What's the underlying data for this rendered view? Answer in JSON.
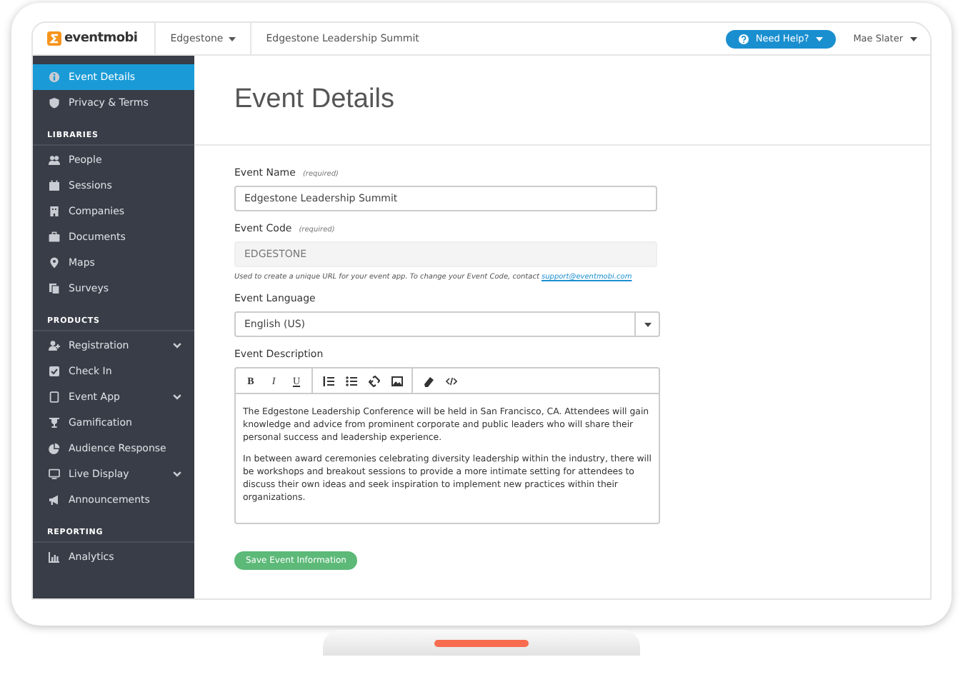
{
  "header": {
    "logo": "eventmobi",
    "organization": "Edgestone",
    "event": "Edgestone Leadership Summit",
    "help_button": "Need Help?",
    "user": "Mae Slater"
  },
  "sidebar": {
    "sections": [
      {
        "items": [
          {
            "label": "Event Details",
            "selected": true,
            "expandable": false
          },
          {
            "label": "Privacy & Terms",
            "selected": false,
            "expandable": false
          }
        ]
      },
      {
        "heading": "LIBRARIES",
        "items": [
          {
            "label": "People",
            "selected": false,
            "expandable": false
          },
          {
            "label": "Sessions",
            "selected": false,
            "expandable": false
          },
          {
            "label": "Companies",
            "selected": false,
            "expandable": false
          },
          {
            "label": "Documents",
            "selected": false,
            "expandable": false
          },
          {
            "label": "Maps",
            "selected": false,
            "expandable": false
          },
          {
            "label": "Surveys",
            "selected": false,
            "expandable": false
          }
        ]
      },
      {
        "heading": "PRODUCTS",
        "items": [
          {
            "label": "Registration",
            "selected": false,
            "expandable": true
          },
          {
            "label": "Check In",
            "selected": false,
            "expandable": false
          },
          {
            "label": "Event App",
            "selected": false,
            "expandable": true
          },
          {
            "label": "Gamification",
            "selected": false,
            "expandable": false
          },
          {
            "label": "Audience Response",
            "selected": false,
            "expandable": false
          },
          {
            "label": "Live Display",
            "selected": false,
            "expandable": true
          },
          {
            "label": "Announcements",
            "selected": false,
            "expandable": false
          }
        ]
      },
      {
        "heading": "REPORTING",
        "items": [
          {
            "label": "Analytics",
            "selected": false,
            "expandable": false
          }
        ]
      }
    ]
  },
  "page_title": "Event Details",
  "form": {
    "fields": [
      {
        "kind": "text",
        "label": "Event Name",
        "note": "(required)",
        "value": "Edgestone Leadership Summit"
      },
      {
        "kind": "readonly",
        "label": "Event Code",
        "note": "(required)",
        "value": "EDGESTONE",
        "help": "Used to create a unique URL for your event app. To change your Event Code, contact ",
        "help_link": "support@eventmobi.com"
      },
      {
        "kind": "select",
        "label": "Event Language",
        "value": "English (US)"
      },
      {
        "kind": "editor",
        "label": "Event Description",
        "toolbar": [
          "B",
          "I",
          "U"
        ],
        "paragraphs": [
          "The Edgestone Leadership Conference will be held in San Francisco, CA. Attendees will gain knowledge and advice from prominent corporate and public leaders who will share their personal success and leadership experience.",
          "In between award ceremonies celebrating diversity leadership within the industry, there will be workshops and breakout sessions to provide a more intimate setting for attendees to discuss their own ideas and seek inspiration to implement new practices within their organizations."
        ]
      }
    ],
    "save_button": "Save Event Information"
  }
}
